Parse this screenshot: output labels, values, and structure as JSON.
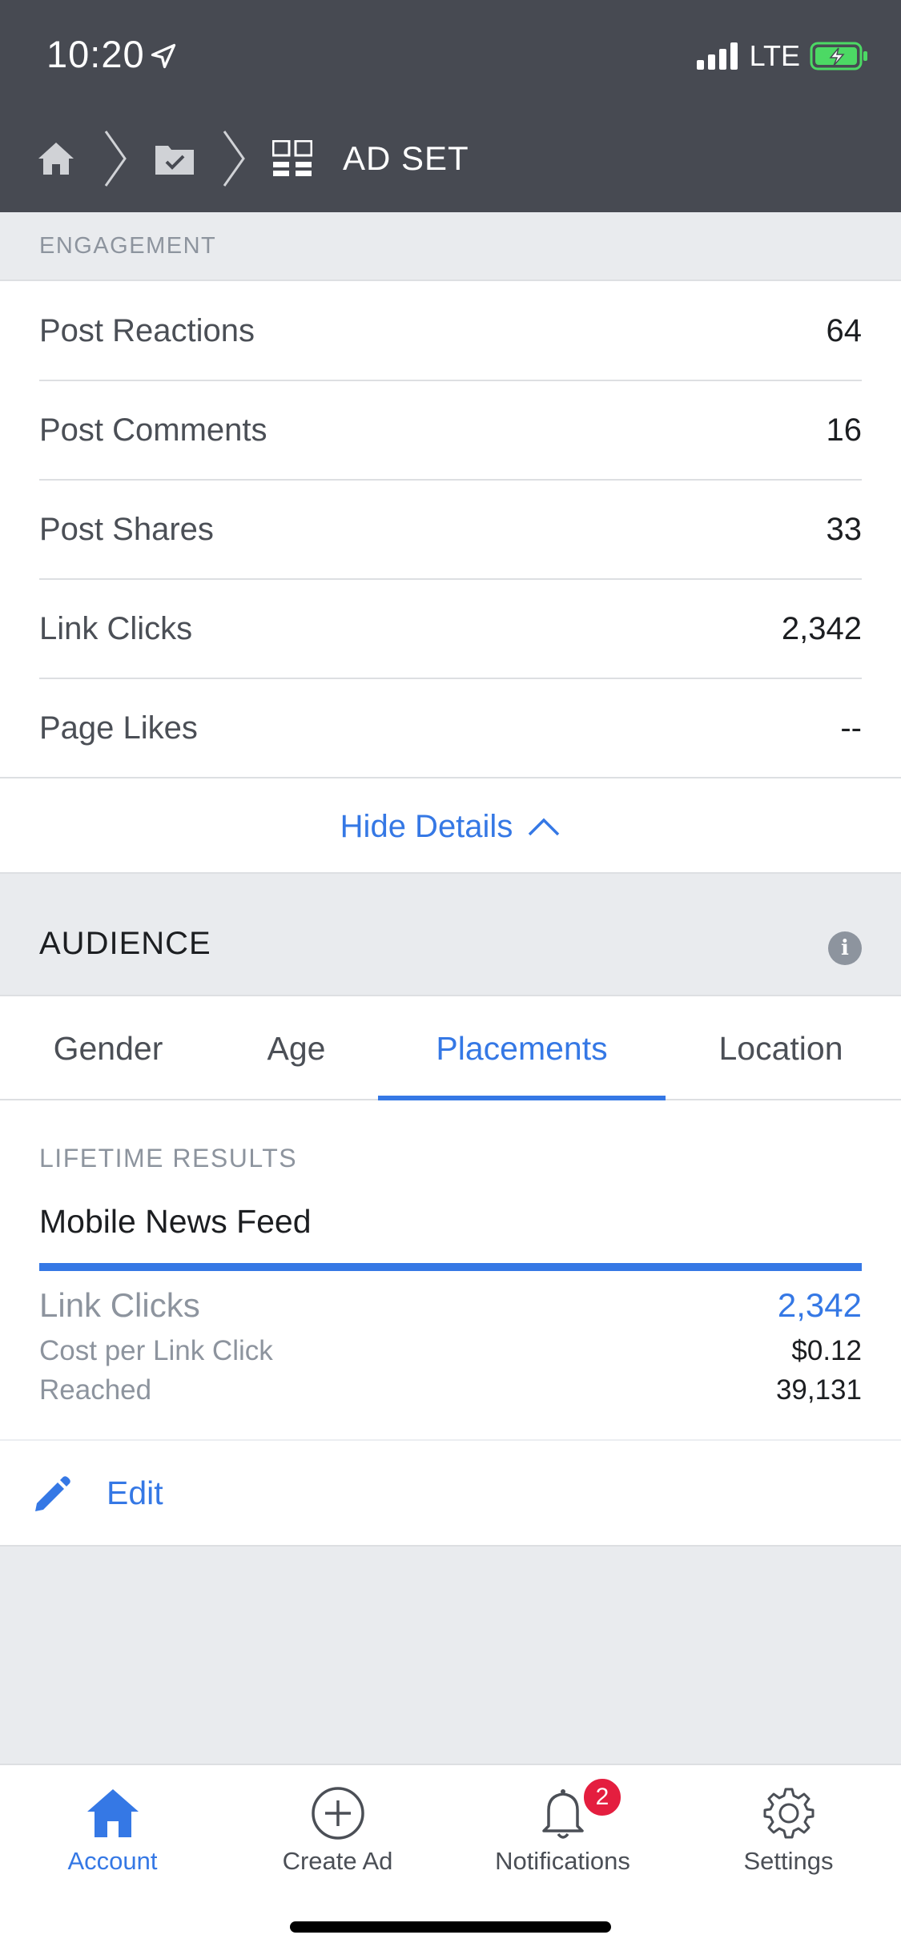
{
  "status_bar": {
    "time": "10:20",
    "network": "LTE"
  },
  "nav": {
    "title": "AD SET"
  },
  "engagement": {
    "section_label": "ENGAGEMENT",
    "rows": [
      {
        "label": "Post Reactions",
        "value": "64"
      },
      {
        "label": "Post Comments",
        "value": "16"
      },
      {
        "label": "Post Shares",
        "value": "33"
      },
      {
        "label": "Link Clicks",
        "value": "2,342"
      },
      {
        "label": "Page Likes",
        "value": "--"
      }
    ],
    "hide_details_label": "Hide Details"
  },
  "audience": {
    "title": "AUDIENCE",
    "info_icon_glyph": "i",
    "tabs": [
      {
        "label": "Gender"
      },
      {
        "label": "Age"
      },
      {
        "label": "Placements"
      },
      {
        "label": "Location"
      }
    ],
    "active_tab": "Placements"
  },
  "results": {
    "label": "LIFETIME RESULTS",
    "placement": "Mobile News Feed",
    "bar_fill_fraction": 1.0,
    "metrics": [
      {
        "label": "Link Clicks",
        "value": "2,342"
      },
      {
        "label": "Cost per Link Click",
        "value": "$0.12"
      },
      {
        "label": "Reached",
        "value": "39,131"
      }
    ]
  },
  "edit": {
    "label": "Edit"
  },
  "tab_bar": {
    "items": [
      {
        "label": "Account",
        "icon": "home-icon"
      },
      {
        "label": "Create Ad",
        "icon": "plus-circle-icon"
      },
      {
        "label": "Notifications",
        "icon": "bell-icon",
        "badge": "2"
      },
      {
        "label": "Settings",
        "icon": "gear-icon"
      }
    ]
  },
  "colors": {
    "accent": "#3578e5",
    "header_bg": "#474a52",
    "page_bg": "#e9ebee",
    "badge": "#e41e3f",
    "battery": "#4cd964"
  }
}
